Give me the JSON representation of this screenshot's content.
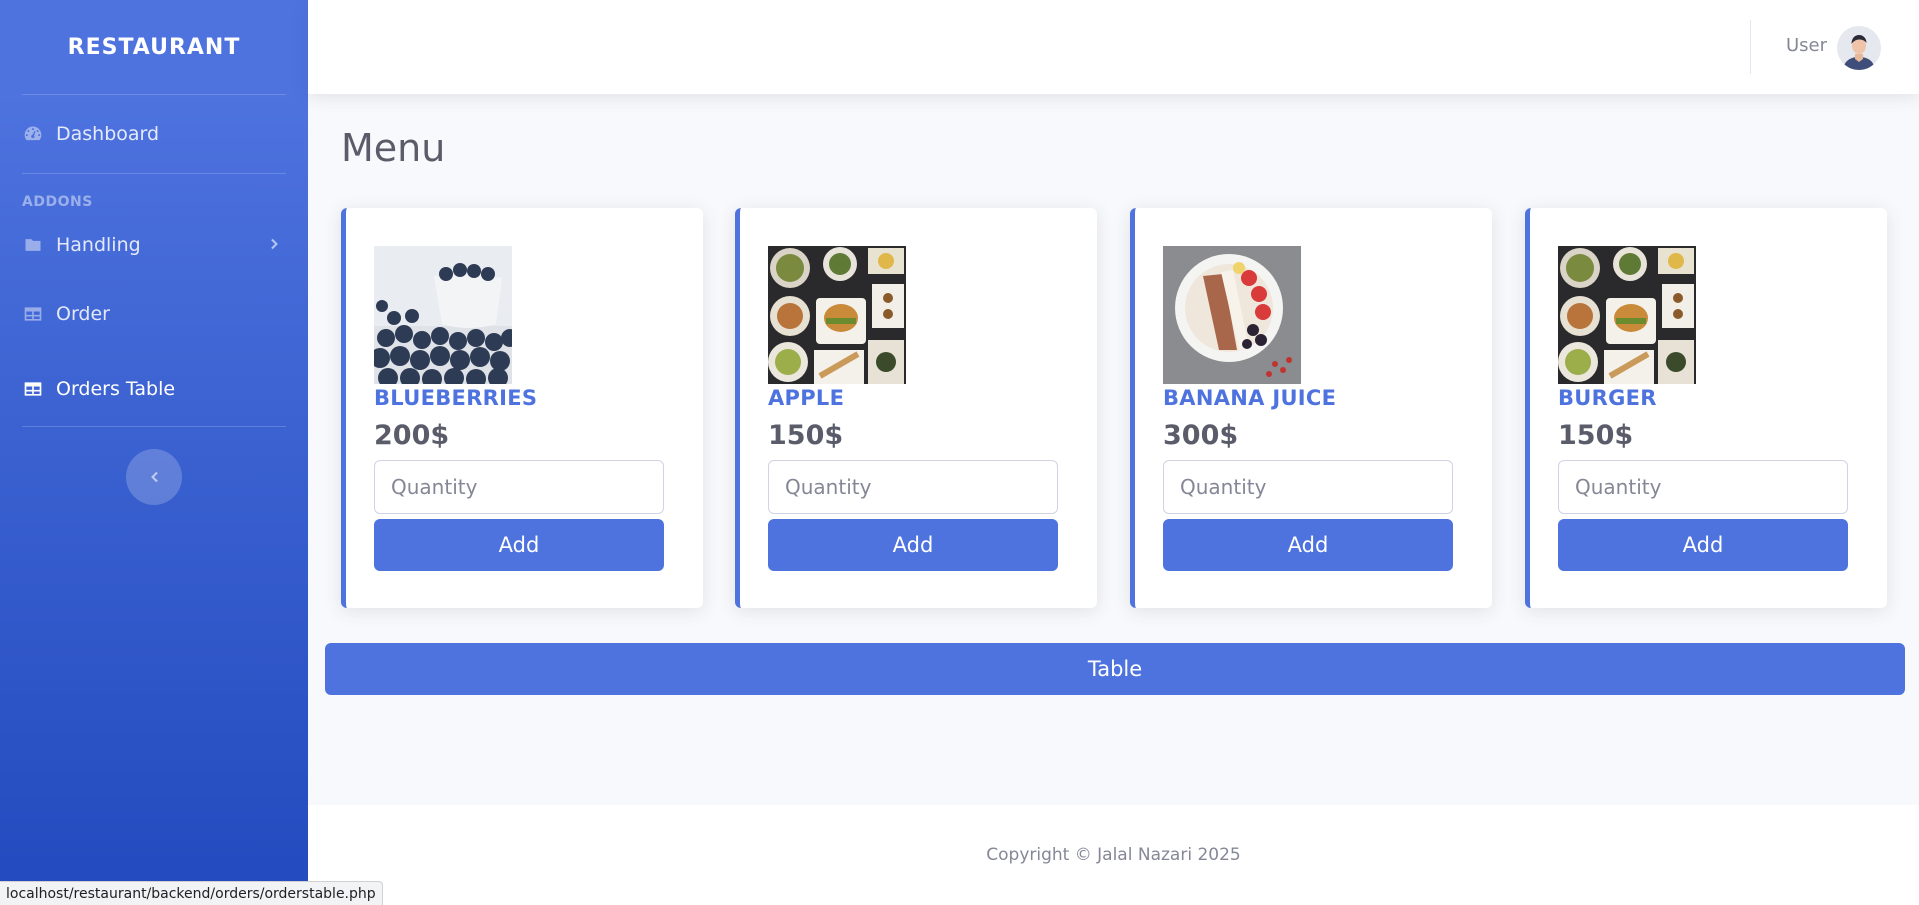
{
  "sidebar": {
    "brand": "RESTAURANT",
    "items": [
      {
        "label": "Dashboard",
        "icon": "dashboard-icon"
      },
      {
        "label": "Handling",
        "icon": "folder-icon"
      },
      {
        "label": "Order",
        "icon": "table-icon"
      },
      {
        "label": "Orders Table",
        "icon": "table-icon"
      }
    ],
    "addons_heading": "ADDONS"
  },
  "topbar": {
    "user_label": "User"
  },
  "main": {
    "title": "Menu",
    "items": [
      {
        "name": "BLUEBERRIES",
        "price": "200$",
        "quantity_placeholder": "Quantity",
        "add_label": "Add"
      },
      {
        "name": "APPLE",
        "price": "150$",
        "quantity_placeholder": "Quantity",
        "add_label": "Add"
      },
      {
        "name": "BANANA JUICE",
        "price": "300$",
        "quantity_placeholder": "Quantity",
        "add_label": "Add"
      },
      {
        "name": "BURGER",
        "price": "150$",
        "quantity_placeholder": "Quantity",
        "add_label": "Add"
      }
    ],
    "table_button": "Table"
  },
  "footer": {
    "copyright": "Copyright © Jalal Nazari 2025"
  },
  "status_bar": {
    "url": "localhost/restaurant/backend/orders/orderstable.php"
  },
  "colors": {
    "primary": "#4e73df",
    "sidebar_gradient_end": "#224abe",
    "background": "#f8f9fc",
    "text": "#5a5c69"
  }
}
